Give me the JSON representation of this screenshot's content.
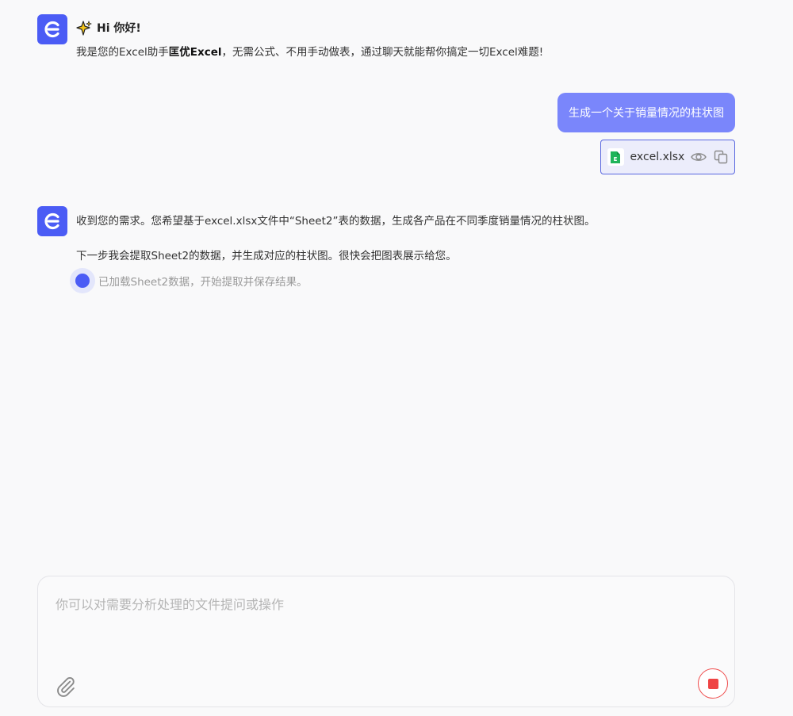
{
  "bot": {
    "avatar_icon": "excel-assistant-logo-icon",
    "greeting": "Hi 你好!",
    "intro_prefix": "我是您的Excel助手",
    "intro_brand": "匡优Excel",
    "intro_suffix": "，无需公式、不用手动做表，通过聊天就能帮你搞定一切Excel难题!"
  },
  "user_message": {
    "text": "生成一个关于销量情况的柱状图",
    "attachment": {
      "file_name": "excel.xlsx",
      "file_icon": "spreadsheet-file-icon",
      "actions": [
        "preview-eye-icon",
        "copy-icon"
      ]
    }
  },
  "bot_reply": {
    "line1": "收到您的需求。您希望基于excel.xlsx文件中“Sheet2”表的数据，生成各产品在不同季度销量情况的柱状图。",
    "line2": "下一步我会提取Sheet2的数据，并生成对应的柱状图。很快会把图表展示给您。",
    "status": "已加载Sheet2数据，开始提取并保存结果。"
  },
  "composer": {
    "placeholder": "你可以对需要分析处理的文件提问或操作",
    "attach_icon": "paperclip-icon",
    "stop_icon": "stop-icon"
  },
  "colors": {
    "accent": "#4b5cf5",
    "user_bubble": "#7a86fb",
    "stop": "#ef4444",
    "background": "#f9f9fa"
  }
}
